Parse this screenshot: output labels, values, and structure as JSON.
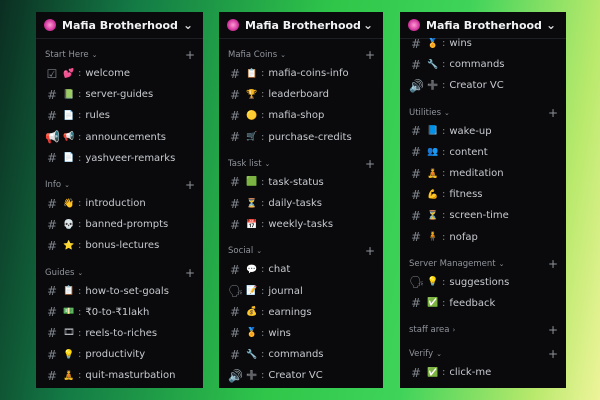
{
  "server_name": "Mafia Brotherhood",
  "panels": [
    {
      "sections": [
        {
          "name": "Start Here",
          "channels": [
            {
              "hash": "☑",
              "emoji": "💕",
              "name": "welcome"
            },
            {
              "hash": "#",
              "emoji": "📗",
              "name": "server-guides"
            },
            {
              "hash": "#",
              "emoji": "📄",
              "name": "rules"
            },
            {
              "hash": "📢",
              "emoji": "📢",
              "name": "announcements"
            },
            {
              "hash": "#",
              "emoji": "📄",
              "name": "yashveer-remarks"
            }
          ]
        },
        {
          "name": "Info",
          "channels": [
            {
              "hash": "#",
              "emoji": "👋",
              "name": "introduction"
            },
            {
              "hash": "#",
              "emoji": "💀",
              "name": "banned-prompts"
            },
            {
              "hash": "#",
              "emoji": "⭐",
              "name": "bonus-lectures"
            }
          ]
        },
        {
          "name": "Guides",
          "channels": [
            {
              "hash": "#",
              "emoji": "📋",
              "name": "how-to-set-goals"
            },
            {
              "hash": "#",
              "emoji": "💵",
              "name": "₹0-to-₹1lakh"
            },
            {
              "hash": "#",
              "emoji": "🎞",
              "name": "reels-to-riches"
            },
            {
              "hash": "#",
              "emoji": "💡",
              "name": "productivity"
            },
            {
              "hash": "#",
              "emoji": "🧘",
              "name": "quit-masturbation"
            }
          ]
        }
      ]
    },
    {
      "sections": [
        {
          "name": "Mafia Coins",
          "channels": [
            {
              "hash": "#",
              "emoji": "📋",
              "name": "mafia-coins-info"
            },
            {
              "hash": "#",
              "emoji": "🏆",
              "name": "leaderboard"
            },
            {
              "hash": "#",
              "emoji": "🟡",
              "name": "mafia-shop"
            },
            {
              "hash": "#",
              "emoji": "🛒",
              "name": "purchase-credits"
            }
          ]
        },
        {
          "name": "Task list",
          "channels": [
            {
              "hash": "#",
              "emoji": "🟩",
              "name": "task-status"
            },
            {
              "hash": "#",
              "emoji": "⏳",
              "name": "daily-tasks"
            },
            {
              "hash": "#",
              "emoji": "📅",
              "name": "weekly-tasks"
            }
          ]
        },
        {
          "name": "Social",
          "channels": [
            {
              "hash": "#",
              "emoji": "💬",
              "name": "chat"
            },
            {
              "hash": "🗣",
              "emoji": "📝",
              "name": "journal"
            },
            {
              "hash": "#",
              "emoji": "💰",
              "name": "earnings"
            },
            {
              "hash": "#",
              "emoji": "🏅",
              "name": "wins"
            },
            {
              "hash": "#",
              "emoji": "🔧",
              "name": "commands"
            },
            {
              "hash": "🔊",
              "emoji": "➕",
              "name": "Creator VC"
            }
          ]
        }
      ]
    },
    {
      "top_channels": [
        {
          "hash": "#",
          "emoji": "🏅",
          "name": "wins"
        },
        {
          "hash": "#",
          "emoji": "🔧",
          "name": "commands"
        },
        {
          "hash": "🔊",
          "emoji": "➕",
          "name": "Creator VC"
        }
      ],
      "sections": [
        {
          "name": "Utilities",
          "channels": [
            {
              "hash": "#",
              "emoji": "📘",
              "name": "wake-up"
            },
            {
              "hash": "#",
              "emoji": "👥",
              "name": "content"
            },
            {
              "hash": "#",
              "emoji": "🧘",
              "name": "meditation"
            },
            {
              "hash": "#",
              "emoji": "💪",
              "name": "fitness"
            },
            {
              "hash": "#",
              "emoji": "⏳",
              "name": "screen-time"
            },
            {
              "hash": "#",
              "emoji": "🧍",
              "name": "nofap"
            }
          ]
        },
        {
          "name": "Server Management",
          "channels": [
            {
              "hash": "🗣",
              "emoji": "💡",
              "name": "suggestions"
            },
            {
              "hash": "#",
              "emoji": "✅",
              "name": "feedback"
            }
          ]
        },
        {
          "name": "staff area",
          "collapsed": true,
          "channels": []
        },
        {
          "name": "Verify",
          "channels": [
            {
              "hash": "#",
              "emoji": "✅",
              "name": "click-me"
            }
          ]
        }
      ]
    }
  ],
  "colors": {
    "accent_green": "#3fd35a",
    "panel_bg": "#0a0a0c"
  }
}
